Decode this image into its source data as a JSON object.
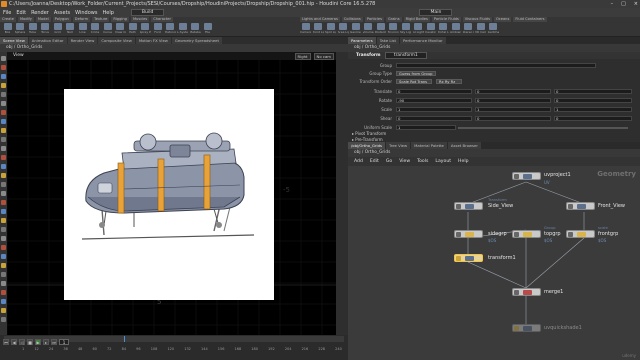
{
  "titlebar": {
    "path": "C:/Users/Joanna/Desktop/Work_Folder/Current_Projects/SESI/Courses/Dropship/HoudiniProjects/Dropship/Dropship_001.hip - Houdini Core 16.5.278",
    "buttons": [
      "–",
      "□",
      "×"
    ]
  },
  "menubar": {
    "items": [
      "File",
      "Edit",
      "Render",
      "Assets",
      "Windows",
      "Help"
    ],
    "build": "Build",
    "desktop": "Main"
  },
  "shelf": {
    "left_tabs": [
      "Create",
      "Modify",
      "Model",
      "Polygon",
      "Deform",
      "Texture",
      "Rigging",
      "Muscles",
      "Character",
      "Constraints",
      "Hair Utils",
      "Guide Process",
      "Terrain FX",
      "Cloud FX",
      "Volume"
    ],
    "left_tools": [
      "Box",
      "Sphere",
      "Tube",
      "Torus",
      "Grid",
      "Null",
      "Line",
      "Circle",
      "Curve",
      "Draw Curve",
      "Path",
      "Spray Paint",
      "Font",
      "Platonic Solids",
      "L-System",
      "Metaball",
      "File"
    ],
    "right_tabs": [
      "Lights and Cameras",
      "Collisions",
      "Particles",
      "Grains",
      "Rigid Bodies",
      "Particle Fluids",
      "Viscous Fluids",
      "Oceans",
      "Fluid Containers",
      "Populate Containers",
      "Container Tools",
      "Pyro FX",
      "Cloth",
      "Solid",
      "Wires",
      "Crowds",
      "Drive Simulation"
    ],
    "right_tools": [
      "Camera",
      "Point Light",
      "Spot Light",
      "Area Light",
      "Geometry Light",
      "Volume Light",
      "Distant Light",
      "Environment Light",
      "Sky Light",
      "GI Light",
      "Caustic Light",
      "Portal Light",
      "Ambient Light",
      "Stereo Camera",
      "VR Camera",
      "Switcher"
    ]
  },
  "left_tabs": [
    "Scene View",
    "Animation Editor",
    "Render View",
    "Composite View",
    "Motion FX View",
    "Geometry Spreadsheet"
  ],
  "left_path": "obj  /  Ortho_Grids",
  "viewport": {
    "label": "View",
    "persp": "Right",
    "cam": "No cam",
    "axis_x": "5",
    "axis_y": "-5"
  },
  "timeline": {
    "frame": "1",
    "ticks": [
      "1",
      "12",
      "24",
      "36",
      "48",
      "60",
      "72",
      "84",
      "96",
      "108",
      "120",
      "132",
      "144",
      "156",
      "168",
      "180",
      "192",
      "204",
      "216",
      "228",
      "240"
    ]
  },
  "param": {
    "tabs": [
      "Parameters",
      "Take List",
      "Performance Monitor"
    ],
    "path": "obj  /  Ortho_Grids",
    "node_type": "Transform",
    "node_name": "transform1",
    "group_label": "Group",
    "group_type_label": "Group Type",
    "group_type": "Guess from Group",
    "order_label": "Transform Order",
    "order_a": "Scale Rot Trans",
    "order_b": "Rx Ry Rz",
    "rows": [
      {
        "label": "Translate",
        "v": [
          "0",
          "0",
          "0"
        ]
      },
      {
        "label": "Rotate",
        "v": [
          "-90",
          "0",
          "0"
        ]
      },
      {
        "label": "Scale",
        "v": [
          "1",
          "1",
          "1"
        ]
      },
      {
        "label": "Shear",
        "v": [
          "0",
          "0",
          "0"
        ]
      }
    ],
    "uniform_label": "Uniform Scale",
    "uniform": "1",
    "sections": [
      "Pivot Transform",
      "Pre-Transform"
    ]
  },
  "net": {
    "tabs": [
      "/obj/Ortho_Grids",
      "Tree View",
      "Material Palette",
      "Asset Browser"
    ],
    "path": "obj  /  Ortho_Grids",
    "menu": [
      "Add",
      "Edit",
      "Go",
      "View",
      "Tools",
      "Layout",
      "Help"
    ],
    "context": "Geometry",
    "nodes": {
      "uvproject": {
        "name": "uvproject1",
        "sub": "UV"
      },
      "side": {
        "name": "Side_View",
        "hint": "Transform"
      },
      "front": {
        "name": "Front_View"
      },
      "sidegrp": {
        "name": "sidegrp",
        "sub": "$OS"
      },
      "topgrp": {
        "name": "topgrp",
        "sub": "$OS"
      },
      "frontgrp": {
        "name": "frontgrp",
        "sub": "$OS"
      },
      "transform1": {
        "name": "transform1"
      },
      "merge": {
        "name": "merge1"
      },
      "uvquick": {
        "name": "uvquickshade1"
      }
    },
    "hints": [
      "Group",
      "Group",
      "scale"
    ]
  },
  "watermark": "udemy"
}
